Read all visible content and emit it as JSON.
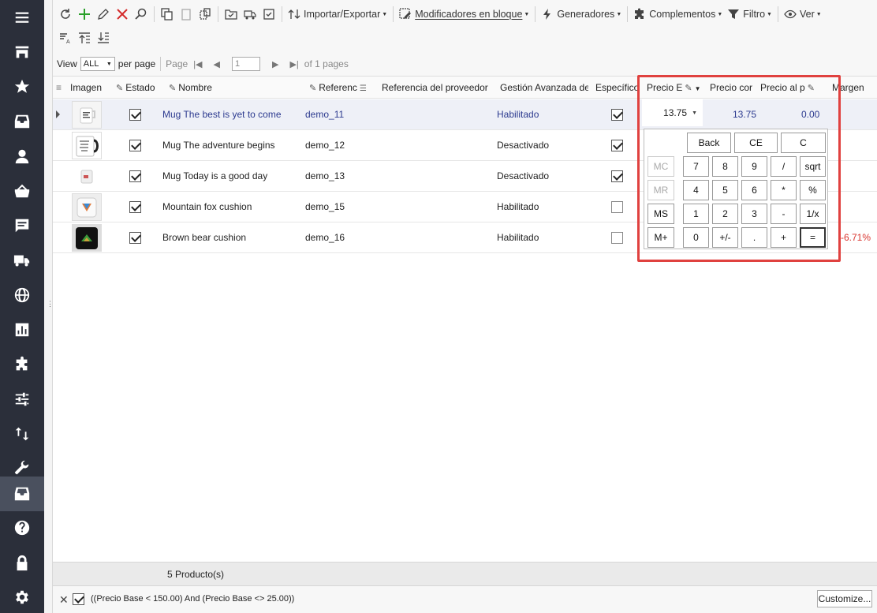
{
  "sidebar": {
    "items": [
      {
        "icon": "menu-icon"
      },
      {
        "icon": "store-icon"
      },
      {
        "icon": "star-icon"
      },
      {
        "icon": "inbox-icon"
      },
      {
        "icon": "user-icon"
      },
      {
        "icon": "basket-icon"
      },
      {
        "icon": "chat-icon"
      },
      {
        "icon": "truck-icon"
      },
      {
        "icon": "globe-icon"
      },
      {
        "icon": "chart-icon"
      },
      {
        "icon": "puzzle-icon"
      },
      {
        "icon": "sliders-icon"
      },
      {
        "icon": "swap-icon"
      },
      {
        "icon": "wrench-icon"
      },
      {
        "icon": "archive-icon"
      },
      {
        "icon": "help-icon"
      },
      {
        "icon": "lock-icon"
      },
      {
        "icon": "gear-icon"
      }
    ]
  },
  "toolbar": {
    "import_export": "Importar/Exportar",
    "bulk_modifiers": "Modificadores en bloque",
    "generators": "Generadores",
    "addons": "Complementos",
    "filter": "Filtro",
    "view": "Ver"
  },
  "pager": {
    "view_label": "View",
    "per_page_value": "ALL",
    "per_page_label": "per page",
    "page_label": "Page",
    "page_value": "1",
    "of_pages": "of 1 pages"
  },
  "columns": {
    "image": "Imagen",
    "status": "Estado",
    "name": "Nombre",
    "reference": "Referenc",
    "supplier_ref": "Referencia del proveedor",
    "advanced_mgmt": "Gestión Avanzada de",
    "specific": "Específico",
    "base_price": "Precio E",
    "cost_price": "Precio cor",
    "unit_price": "Precio al p",
    "margin": "Margen"
  },
  "rows": [
    {
      "name": "Mug The best is yet to come",
      "reference": "demo_11",
      "advanced": "Habilitado",
      "status": true,
      "specific": true
    },
    {
      "name": "Mug The adventure begins",
      "reference": "demo_12",
      "advanced": "Desactivado",
      "status": true,
      "specific": true
    },
    {
      "name": "Mug Today is a good day",
      "reference": "demo_13",
      "advanced": "Desactivado",
      "status": true,
      "specific": true
    },
    {
      "name": "Mountain fox cushion",
      "reference": "demo_15",
      "advanced": "Habilitado",
      "status": true,
      "specific": false
    },
    {
      "name": "Brown bear cushion",
      "reference": "demo_16",
      "advanced": "Habilitado",
      "status": true,
      "specific": false
    }
  ],
  "row1_prices": {
    "editor_value": "13.75",
    "cost": "13.75",
    "unit": "0.00"
  },
  "row5_margin": "-6.71%",
  "calculator": {
    "top": [
      "Back",
      "CE",
      "C"
    ],
    "rows": [
      [
        "MC",
        "7",
        "8",
        "9",
        "/",
        "sqrt"
      ],
      [
        "MR",
        "4",
        "5",
        "6",
        "*",
        "%"
      ],
      [
        "MS",
        "1",
        "2",
        "3",
        "-",
        "1/x"
      ],
      [
        "M+",
        "0",
        "+/-",
        ".",
        "+",
        "="
      ]
    ]
  },
  "footer": {
    "count": "5 Producto(s)",
    "filter_text": "((Precio Base < 150.00) And (Precio Base <> 25.00))",
    "customize": "Customize..."
  },
  "colors": {
    "sidebar": "#2b2f3a",
    "highlight_box": "#e0413f",
    "link_blue": "#2c3a8f",
    "negative": "#d9352f"
  }
}
